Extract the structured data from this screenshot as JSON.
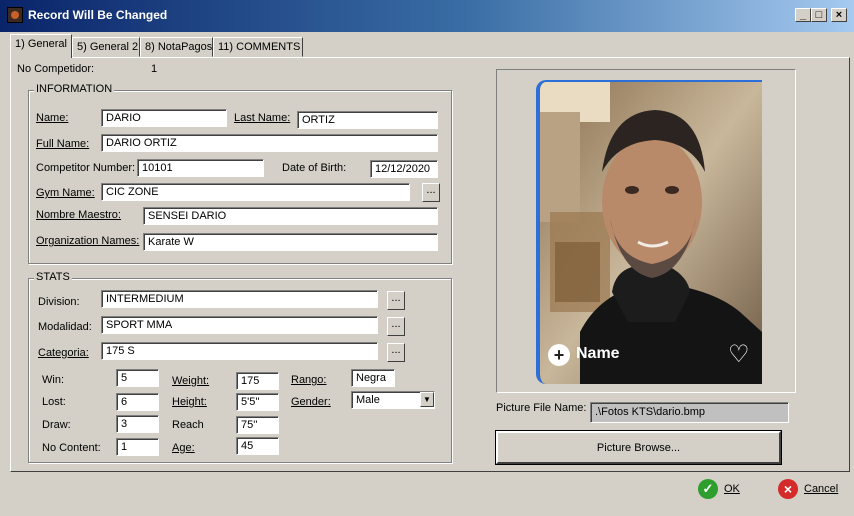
{
  "window": {
    "title": "Record Will Be Changed",
    "min_symbol": "_",
    "max_symbol": "□",
    "close_symbol": "×"
  },
  "tabs": [
    {
      "label": "1) General",
      "active": true
    },
    {
      "label": "5) General 2",
      "active": false
    },
    {
      "label": "8) NotaPagos",
      "active": false
    },
    {
      "label": "11) COMMENTS",
      "active": false
    }
  ],
  "competitor_no": {
    "label": "No Competidor:",
    "value": "1"
  },
  "information": {
    "legend": "INFORMATION",
    "name": {
      "label": "Name:",
      "value": "DARIO"
    },
    "last_name": {
      "label": "Last Name:",
      "value": "ORTIZ"
    },
    "full_name": {
      "label": "Full Name:",
      "value": "DARIO ORTIZ"
    },
    "competitor_number": {
      "label": "Competitor Number:",
      "value": "10101"
    },
    "date_of_birth": {
      "label": "Date of Birth:",
      "value": "12/12/2020"
    },
    "gym_name": {
      "label": "Gym Name:",
      "value": "CIC ZONE"
    },
    "nombre_maestro": {
      "label": "Nombre Maestro:",
      "value": "SENSEI DARIO"
    },
    "organization_names": {
      "label": "Organization Names:",
      "value": "Karate W"
    }
  },
  "stats": {
    "legend": "STATS",
    "division": {
      "label": "Division:",
      "value": "INTERMEDIUM"
    },
    "modalidad": {
      "label": "Modalidad:",
      "value": "SPORT MMA"
    },
    "categoria": {
      "label": "Categoria:",
      "value": "175 S"
    },
    "win": {
      "label": "Win:",
      "value": "5"
    },
    "lost": {
      "label": "Lost:",
      "value": "6"
    },
    "draw": {
      "label": "Draw:",
      "value": "3"
    },
    "no_content": {
      "label": "No Content:",
      "value": "1"
    },
    "weight": {
      "label": "Weight:",
      "value": "175"
    },
    "height": {
      "label": "Height:",
      "value": "5'5''"
    },
    "reach": {
      "label": "Reach",
      "value": "75''"
    },
    "age": {
      "label": "Age:",
      "value": "45"
    },
    "rango": {
      "label": "Rango:",
      "value": "Negra"
    },
    "gender": {
      "label": "Gender:",
      "value": "Male"
    }
  },
  "ellipsis": "...",
  "photo": {
    "overlay_name": "Name",
    "plus_symbol": "+",
    "heart_symbol": "♡"
  },
  "picture": {
    "file_label": "Picture File Name:",
    "file_value": ".\\Fotos KTS\\dario.bmp",
    "browse_label": "Picture Browse..."
  },
  "footer": {
    "ok_label": "OK",
    "cancel_label": "Cancel",
    "ok_color": "#2e9e2e",
    "cancel_color": "#d42a2a"
  }
}
